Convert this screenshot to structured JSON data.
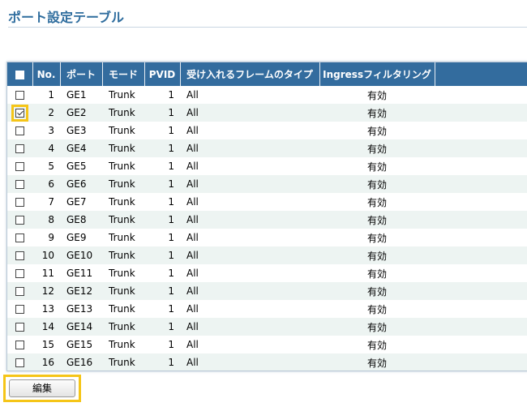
{
  "page": {
    "title": "ポート設定テーブル"
  },
  "table": {
    "headers": {
      "no": "No.",
      "port": "ポート",
      "mode": "モード",
      "pvid": "PVID",
      "frame_type": "受け入れるフレームのタイプ",
      "ingress": "Ingressフィルタリング"
    },
    "rows": [
      {
        "no": "1",
        "port": "GE1",
        "mode": "Trunk",
        "pvid": "1",
        "frame": "All",
        "filter": "有効",
        "checked": false
      },
      {
        "no": "2",
        "port": "GE2",
        "mode": "Trunk",
        "pvid": "1",
        "frame": "All",
        "filter": "有効",
        "checked": true
      },
      {
        "no": "3",
        "port": "GE3",
        "mode": "Trunk",
        "pvid": "1",
        "frame": "All",
        "filter": "有効",
        "checked": false
      },
      {
        "no": "4",
        "port": "GE4",
        "mode": "Trunk",
        "pvid": "1",
        "frame": "All",
        "filter": "有効",
        "checked": false
      },
      {
        "no": "5",
        "port": "GE5",
        "mode": "Trunk",
        "pvid": "1",
        "frame": "All",
        "filter": "有効",
        "checked": false
      },
      {
        "no": "6",
        "port": "GE6",
        "mode": "Trunk",
        "pvid": "1",
        "frame": "All",
        "filter": "有効",
        "checked": false
      },
      {
        "no": "7",
        "port": "GE7",
        "mode": "Trunk",
        "pvid": "1",
        "frame": "All",
        "filter": "有効",
        "checked": false
      },
      {
        "no": "8",
        "port": "GE8",
        "mode": "Trunk",
        "pvid": "1",
        "frame": "All",
        "filter": "有効",
        "checked": false
      },
      {
        "no": "9",
        "port": "GE9",
        "mode": "Trunk",
        "pvid": "1",
        "frame": "All",
        "filter": "有効",
        "checked": false
      },
      {
        "no": "10",
        "port": "GE10",
        "mode": "Trunk",
        "pvid": "1",
        "frame": "All",
        "filter": "有効",
        "checked": false
      },
      {
        "no": "11",
        "port": "GE11",
        "mode": "Trunk",
        "pvid": "1",
        "frame": "All",
        "filter": "有効",
        "checked": false
      },
      {
        "no": "12",
        "port": "GE12",
        "mode": "Trunk",
        "pvid": "1",
        "frame": "All",
        "filter": "有効",
        "checked": false
      },
      {
        "no": "13",
        "port": "GE13",
        "mode": "Trunk",
        "pvid": "1",
        "frame": "All",
        "filter": "有効",
        "checked": false
      },
      {
        "no": "14",
        "port": "GE14",
        "mode": "Trunk",
        "pvid": "1",
        "frame": "All",
        "filter": "有効",
        "checked": false
      },
      {
        "no": "15",
        "port": "GE15",
        "mode": "Trunk",
        "pvid": "1",
        "frame": "All",
        "filter": "有効",
        "checked": false
      },
      {
        "no": "16",
        "port": "GE16",
        "mode": "Trunk",
        "pvid": "1",
        "frame": "All",
        "filter": "有効",
        "checked": false
      }
    ]
  },
  "actions": {
    "edit_label": "編集"
  },
  "colors": {
    "header_bg": "#336c9e",
    "title": "#2f6d9e",
    "highlight": "#f5c518",
    "stripe": "#edf4f2"
  }
}
